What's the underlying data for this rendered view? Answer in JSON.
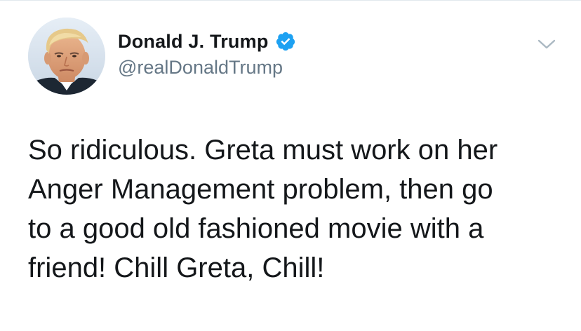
{
  "tweet": {
    "author": {
      "display_name": "Donald J. Trump",
      "handle": "@realDonaldTrump",
      "verified": true,
      "verified_icon": "verified-badge-icon",
      "avatar": "profile-photo"
    },
    "text": "So ridiculous. Greta must work on her\nAnger Management problem, then go\nto a good old fashioned movie with a\nfriend! Chill Greta, Chill!",
    "menu_icon": "chevron-down-icon"
  },
  "colors": {
    "text": "#14171a",
    "secondary_text": "#657786",
    "verified_blue": "#1da1f2",
    "divider": "#e1e8ed"
  }
}
